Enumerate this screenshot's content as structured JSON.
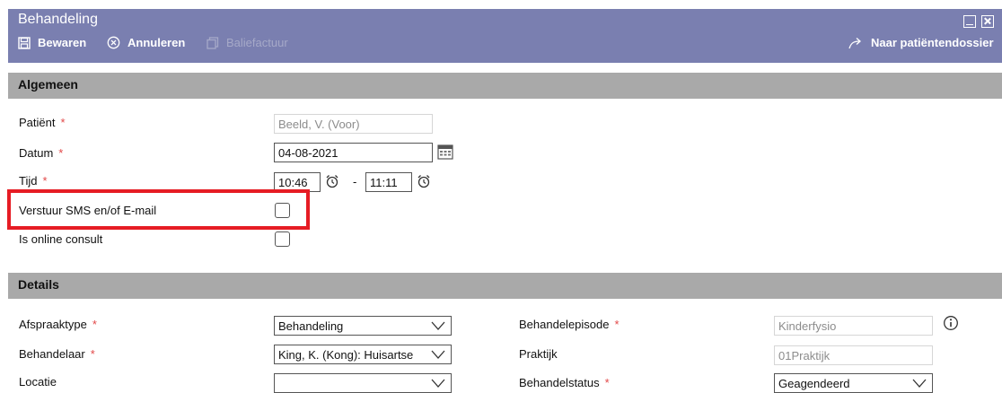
{
  "window": {
    "title": "Behandeling"
  },
  "toolbar": {
    "save_label": "Bewaren",
    "cancel_label": "Annuleren",
    "invoice_label": "Baliefactuur",
    "patient_record_label": "Naar patiëntendossier"
  },
  "sections": {
    "general": "Algemeen",
    "details": "Details"
  },
  "general": {
    "patient_label": "Patiënt",
    "patient_value": "Beeld, V. (Voor)",
    "date_label": "Datum",
    "date_value": "04-08-2021",
    "time_label": "Tijd",
    "time_start": "10:46",
    "time_separator": "-",
    "time_end": "11:11",
    "sms_label": "Verstuur SMS en/of E-mail",
    "sms_checked": false,
    "online_label": "Is online consult",
    "online_checked": false
  },
  "details": {
    "appointment_type_label": "Afspraaktype",
    "appointment_type_value": "Behandeling",
    "practitioner_label": "Behandelaar",
    "practitioner_value": "King, K. (Kong): Huisartse",
    "location_label": "Locatie",
    "location_value": "",
    "episode_label": "Behandelepisode",
    "episode_value": "Kinderfysio",
    "practice_label": "Praktijk",
    "practice_value": "01Praktijk",
    "status_label": "Behandelstatus",
    "status_value": "Geagendeerd"
  },
  "required_marker": "*",
  "colors": {
    "header": "#7a7fb0",
    "section": "#a9a9a9",
    "required": "#e24848",
    "highlight": "#e61c24"
  }
}
